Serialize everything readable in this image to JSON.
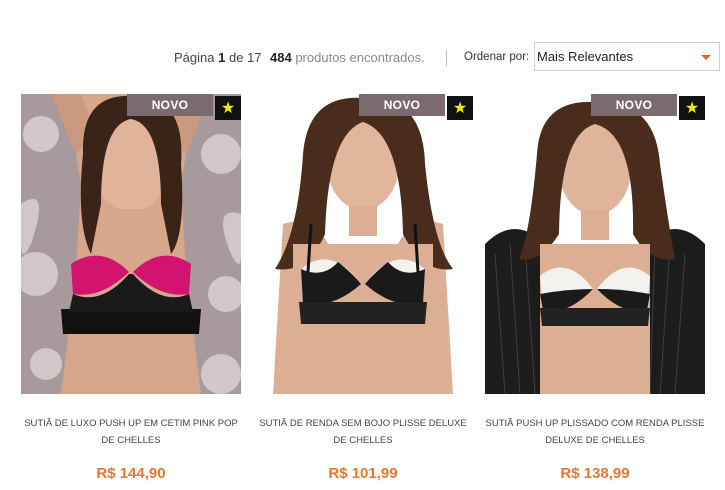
{
  "pagination": {
    "prefix": "Página",
    "current": "1",
    "of": "de",
    "total": "17"
  },
  "results": {
    "count": "484",
    "label": "produtos encontrados."
  },
  "sort": {
    "label": "Ordenar por:",
    "selected": "Mais Relevantes"
  },
  "colors": {
    "accent": "#e8772e",
    "badge": "#7b6a6e",
    "star": "#f6e71a"
  },
  "products": [
    {
      "badge": "NOVO",
      "badge_icon": "star-icon",
      "name_line1": "SUTIÃ DE LUXO PUSH UP EM CETIM PINK POP",
      "name_line2": "DE CHELLES",
      "price": "R$ 144,90"
    },
    {
      "badge": "NOVO",
      "badge_icon": "star-icon",
      "name_line1": "SUTIÃ DE RENDA SEM BOJO PLISSE DELUXE",
      "name_line2": "DE CHELLES",
      "price": "R$ 101,99"
    },
    {
      "badge": "NOVO",
      "badge_icon": "star-icon",
      "name_line1": "SUTIÃ PUSH UP PLISSADO COM RENDA PLISSE",
      "name_line2": "DELUXE DE CHELLES",
      "price": "R$ 138,99"
    }
  ]
}
